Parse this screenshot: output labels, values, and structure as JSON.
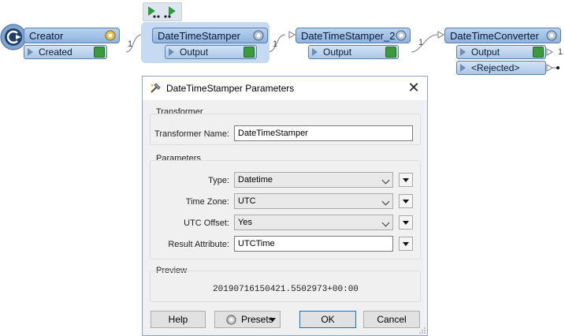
{
  "canvas": {
    "creator": {
      "title": "Creator",
      "port": "Created"
    },
    "stamper": {
      "title": "DateTimeStamper",
      "port": "Output"
    },
    "stamper2": {
      "title": "DateTimeStamper_2",
      "port": "Output"
    },
    "converter": {
      "title": "DateTimeConverter",
      "port_output": "Output",
      "port_rejected": "<Rejected>"
    },
    "counts": {
      "c1": "1",
      "c2": "1",
      "c3": "1",
      "c4": "1"
    }
  },
  "dialog": {
    "title": "DateTimeStamper Parameters",
    "transformer_group": "Transformer",
    "transformer_name_label": "Transformer Name:",
    "transformer_name_value": "DateTimeStamper",
    "parameters_group": "Parameters",
    "type_label": "Type:",
    "type_value": "Datetime",
    "timezone_label": "Time Zone:",
    "timezone_value": "UTC",
    "utc_offset_label": "UTC Offset:",
    "utc_offset_value": "Yes",
    "result_label": "Result Attribute:",
    "result_value": "UTCTime",
    "preview_group": "Preview",
    "preview_value": "20190716150421.5502973+00:00",
    "buttons": {
      "help": "Help",
      "presets": "Presets",
      "ok": "OK",
      "cancel": "Cancel"
    }
  },
  "colors": {
    "node_header": "#9fc0e6",
    "selected": "#c6dbf1",
    "inspect_green": "#3b9a3a",
    "ok_border": "#0078d7"
  }
}
